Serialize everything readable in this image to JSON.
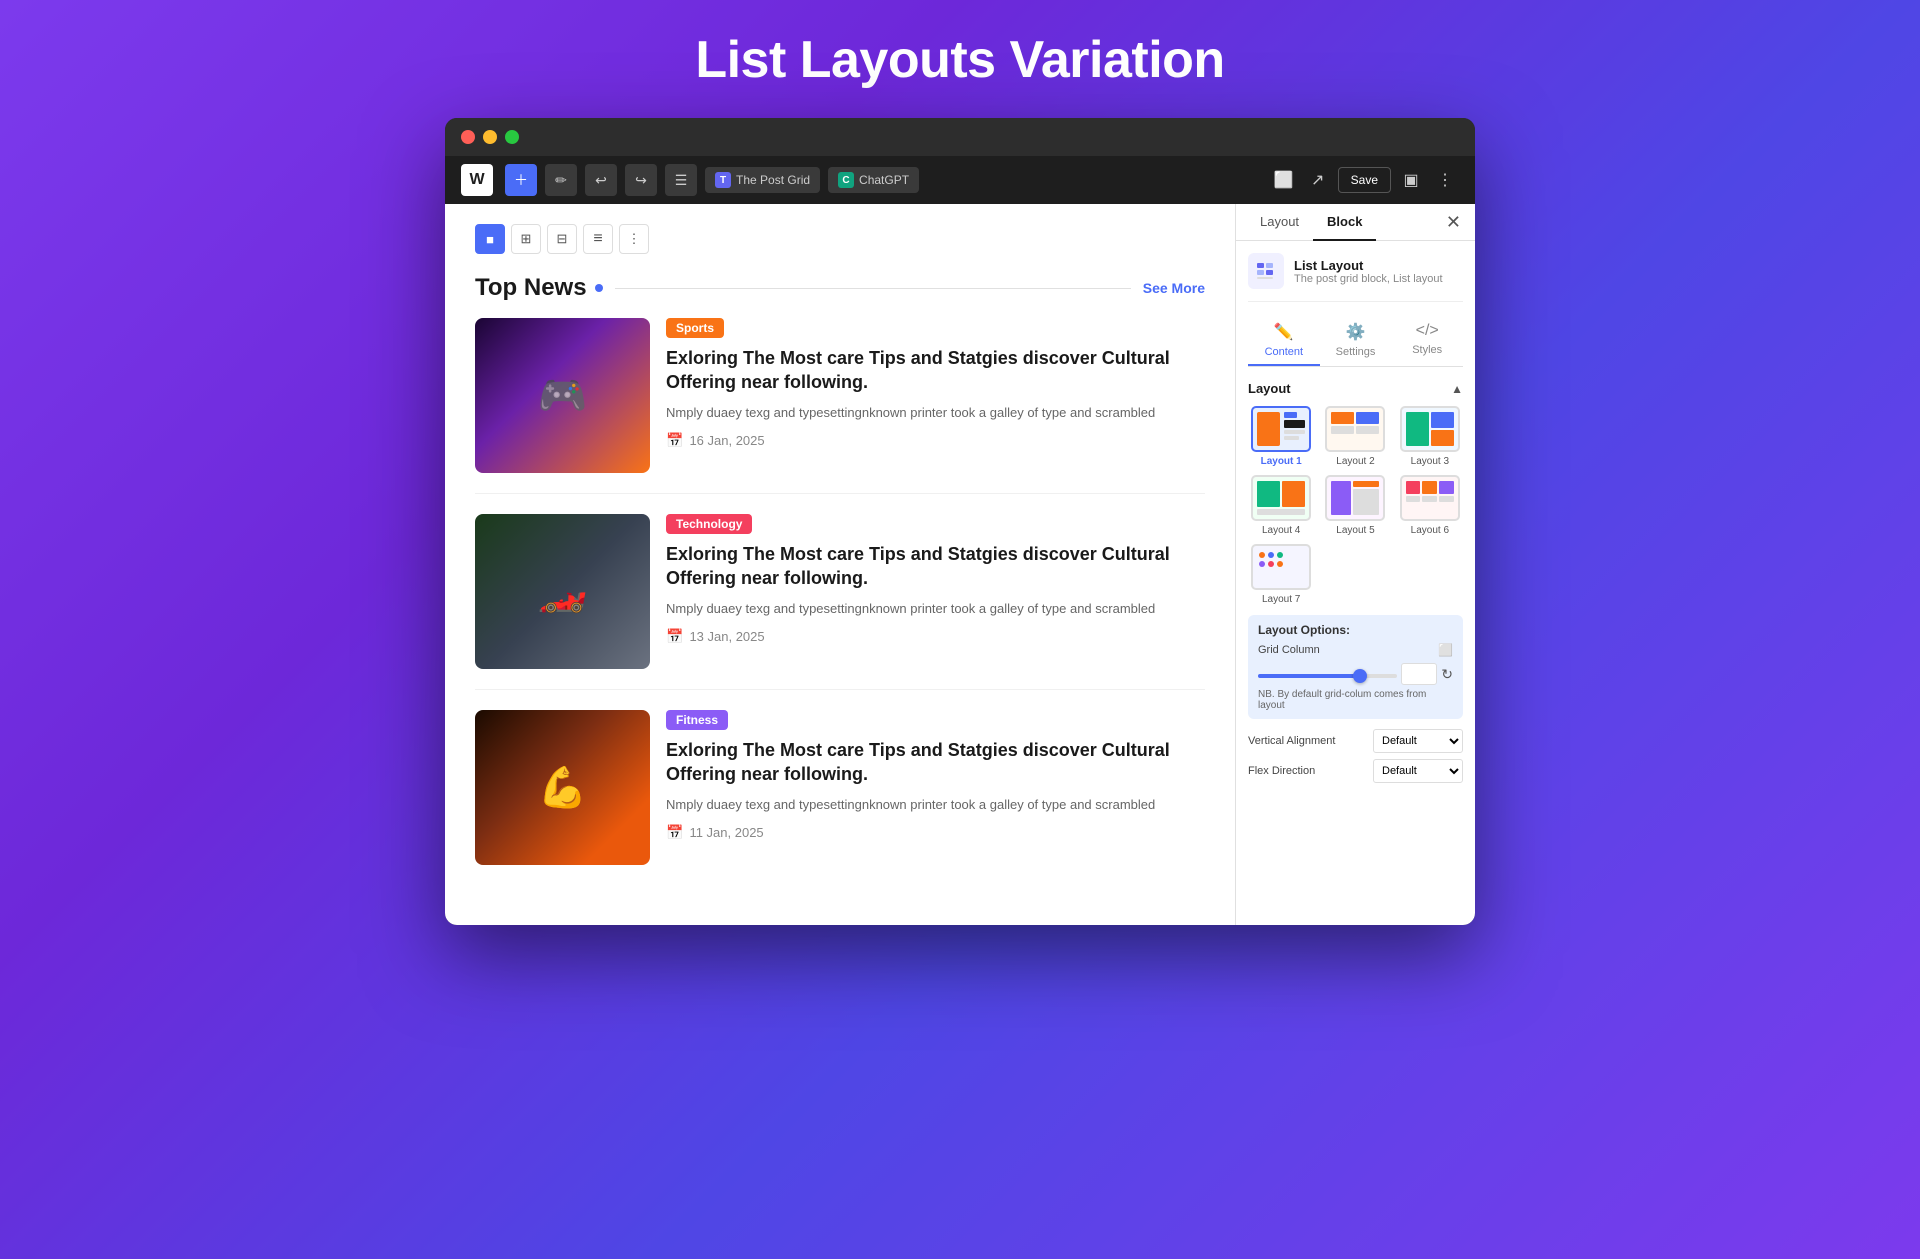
{
  "page": {
    "title": "List Layouts Variation"
  },
  "browser": {
    "dots": [
      "red",
      "yellow",
      "green"
    ]
  },
  "toolbar": {
    "wp_logo": "W",
    "add_label": "+",
    "pencil_label": "✏",
    "undo_label": "↩",
    "redo_label": "↪",
    "list_label": "☰",
    "plugin1_label": "The Post Grid",
    "plugin2_label": "ChatGPT",
    "save_label": "Save"
  },
  "block_toolbar": {
    "buttons": [
      "■",
      "⊞",
      "⊟",
      "≡",
      "⋮"
    ]
  },
  "section": {
    "title": "Top News",
    "see_more": "See More"
  },
  "posts": [
    {
      "category": "Sports",
      "category_class": "cat-sports",
      "img_class": "img-sports",
      "title": "Exloring The Most care Tips and Statgies discover Cultural Offering near following.",
      "excerpt": "Nmply duaey texg and typesettingnknown printer took a galley of type and scrambled",
      "date": "16 Jan, 2025"
    },
    {
      "category": "Technology",
      "category_class": "cat-technology",
      "img_class": "img-tech",
      "title": "Exloring The Most care Tips and Statgies discover Cultural Offering near following.",
      "excerpt": "Nmply duaey texg and typesettingnknown printer took a galley of type and scrambled",
      "date": "13 Jan, 2025"
    },
    {
      "category": "Fitness",
      "category_class": "cat-fitness",
      "img_class": "img-fitness",
      "title": "Exloring The Most care Tips and Statgies discover Cultural Offering near following.",
      "excerpt": "Nmply duaey texg and typesettingnknown printer took a galley of type and scrambled",
      "date": "11 Jan, 2025"
    }
  ],
  "right_panel": {
    "tab1": "Layout",
    "tab2": "Block",
    "block_name": "List Layout",
    "block_desc": "The post grid block, List layout",
    "content_tab": "Content",
    "settings_tab": "Settings",
    "styles_tab": "Styles",
    "layout_section_title": "Layout",
    "layouts": [
      {
        "id": 1,
        "label": "Layout 1",
        "selected": true
      },
      {
        "id": 2,
        "label": "Layout 2",
        "selected": false
      },
      {
        "id": 3,
        "label": "Layout 3",
        "selected": false
      },
      {
        "id": 4,
        "label": "Layout 4",
        "selected": false
      },
      {
        "id": 5,
        "label": "Layout 5",
        "selected": false
      },
      {
        "id": 6,
        "label": "Layout 6",
        "selected": false
      },
      {
        "id": 7,
        "label": "Layout 7",
        "selected": false
      }
    ],
    "layout_options_title": "Layout Options:",
    "grid_column_label": "Grid Column",
    "nb_text": "NB. By default grid-colum comes from layout",
    "vertical_alignment_label": "Vertical Alignment",
    "vertical_alignment_value": "Default",
    "flex_direction_label": "Flex Direction",
    "flex_direction_value": "Default"
  }
}
